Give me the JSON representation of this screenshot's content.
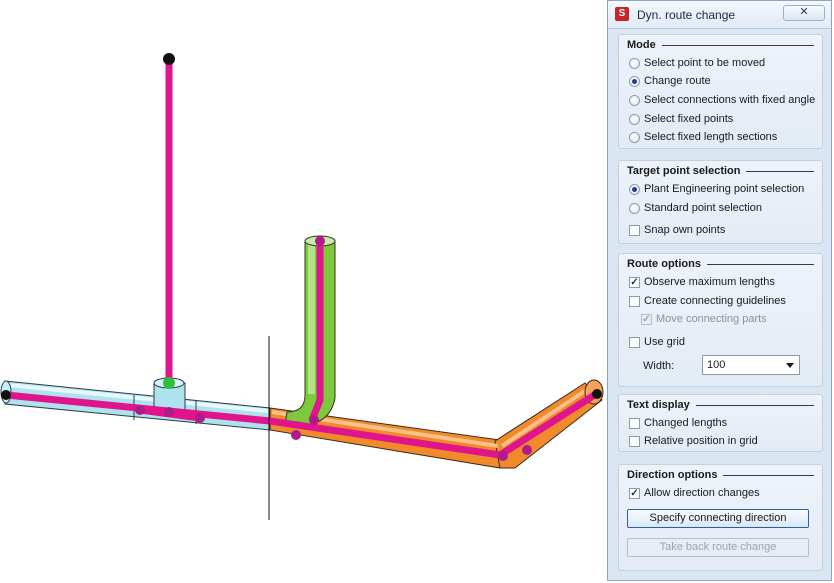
{
  "dialog": {
    "title": "Dyn. route change",
    "close_glyph": "✕",
    "icon": "app-logo-icon"
  },
  "mode": {
    "title": "Mode",
    "options": [
      {
        "label": "Select point to be moved",
        "selected": false
      },
      {
        "label": "Change route",
        "selected": true
      },
      {
        "label": "Select connections with fixed angle",
        "selected": false
      },
      {
        "label": "Select fixed points",
        "selected": false
      },
      {
        "label": "Select fixed length sections",
        "selected": false
      }
    ]
  },
  "target": {
    "title": "Target point selection",
    "options": [
      {
        "label": "Plant Engineering point selection",
        "selected": true
      },
      {
        "label": "Standard point selection",
        "selected": false
      }
    ],
    "snap_label": "Snap own points",
    "snap_checked": false
  },
  "route": {
    "title": "Route options",
    "observe_label": "Observe maximum lengths",
    "create_label": "Create connecting guidelines",
    "move_label": "Move connecting parts",
    "grid_label": "Use grid",
    "width_label": "Width:",
    "width_value": "100"
  },
  "text_display": {
    "title": "Text display",
    "changed_label": "Changed lengths",
    "relative_label": "Relative position in grid"
  },
  "direction": {
    "title": "Direction options",
    "allow_label": "Allow direction changes",
    "specify_button": "Specify connecting direction",
    "takeback_button": "Take back route change"
  },
  "check_glyph": "✓",
  "colors": {
    "route_line": "#e0148c",
    "pipe_blue": "#aee3ee",
    "pipe_orange": "#f08a2a",
    "pipe_green": "#7ec83c",
    "dialog_bg": "#dbe6f3"
  }
}
